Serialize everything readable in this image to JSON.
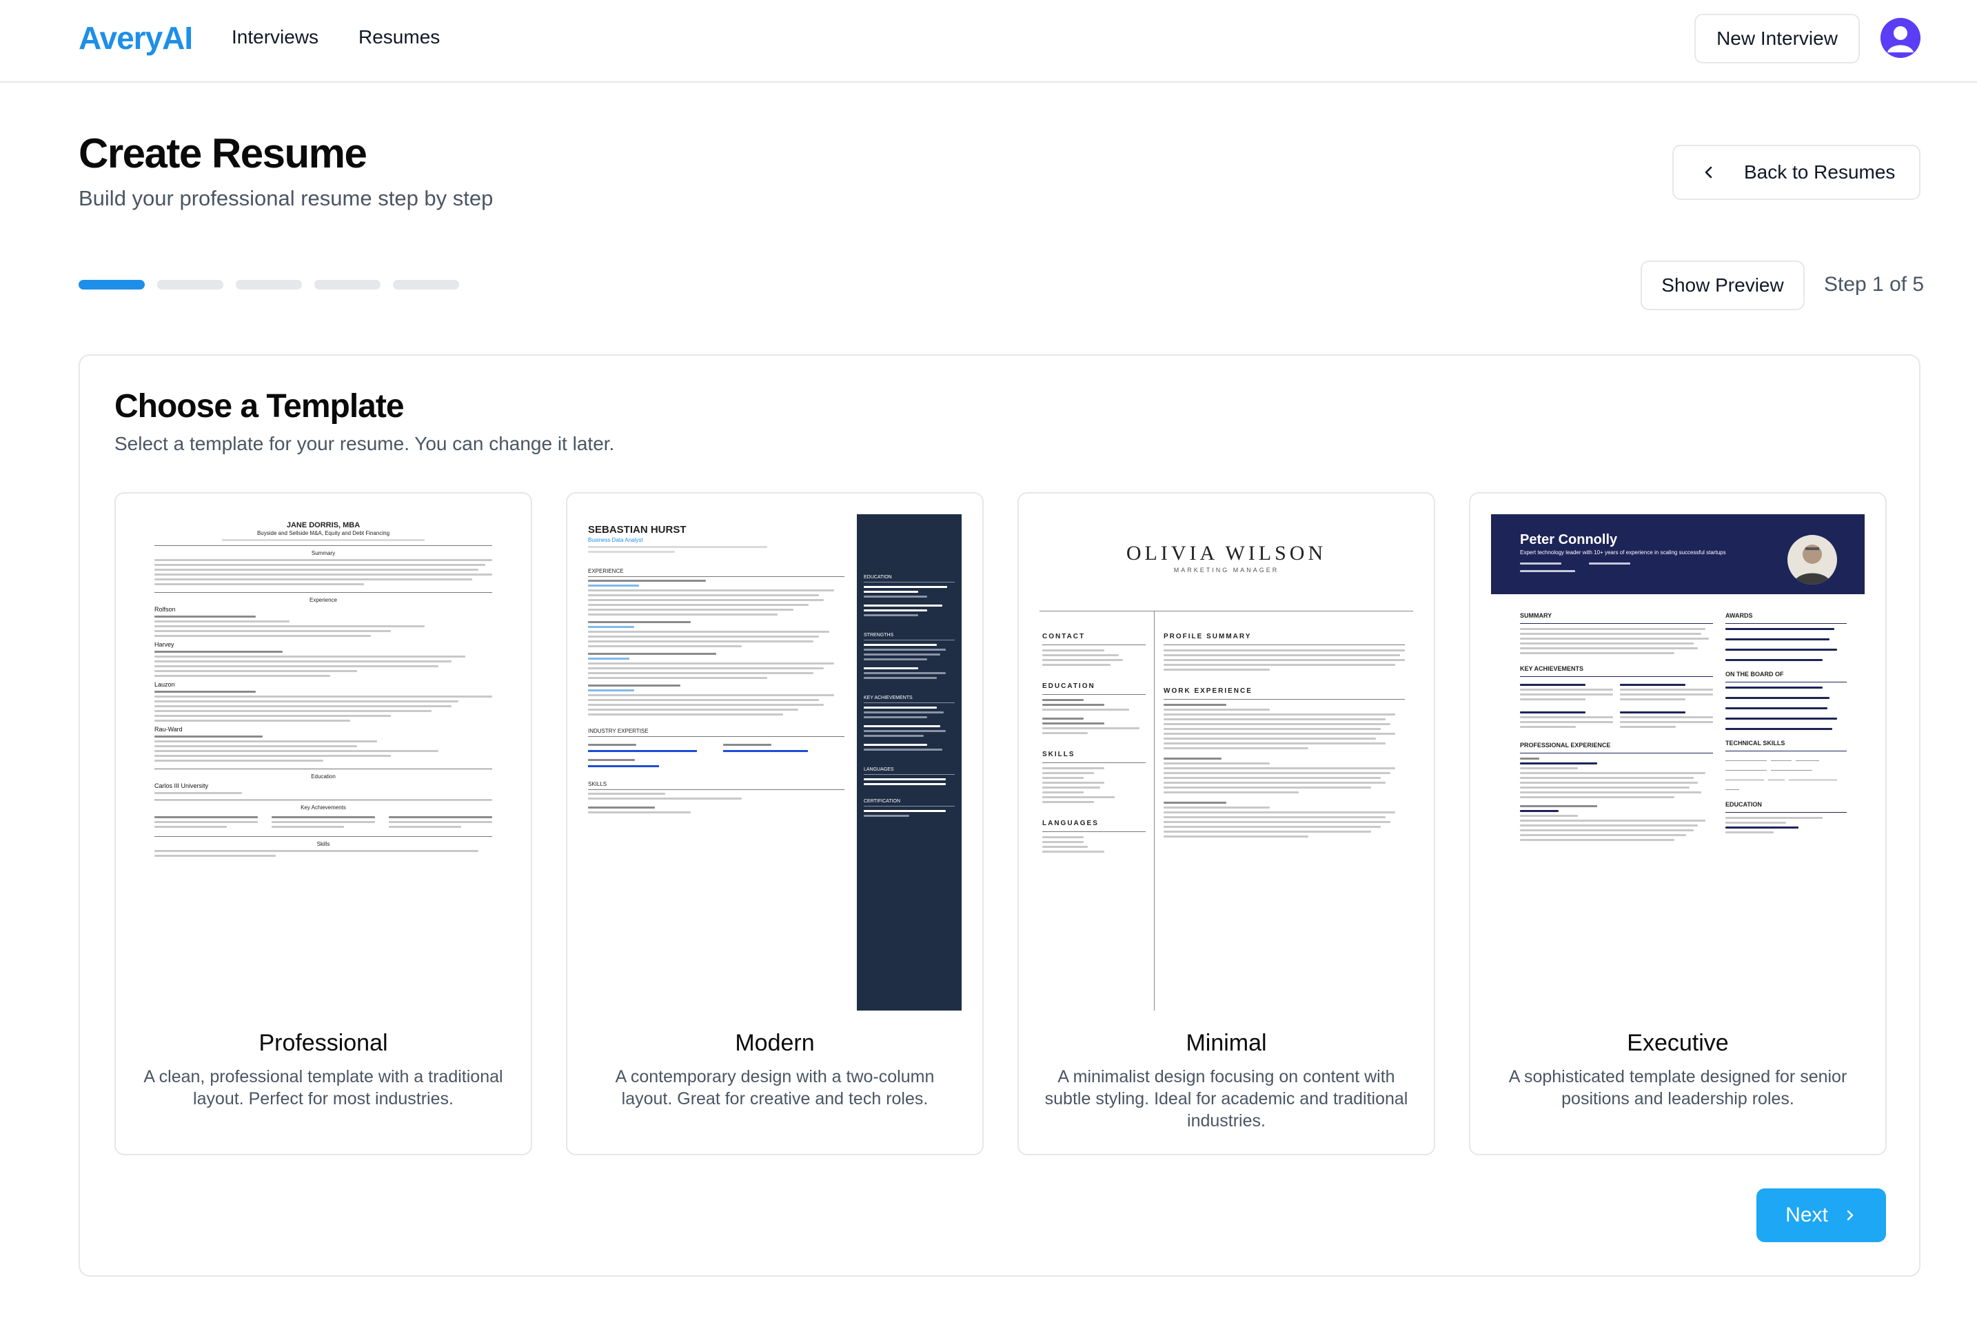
{
  "header": {
    "brand": "AveryAI",
    "nav": [
      "Interviews",
      "Resumes"
    ],
    "new_interview": "New Interview",
    "avatar_icon": "user-avatar-icon"
  },
  "page": {
    "title": "Create Resume",
    "subtitle": "Build your professional resume step by step",
    "back_button": "Back to Resumes",
    "show_preview": "Show Preview",
    "step_label": "Step 1 of 5",
    "progress": {
      "current": 1,
      "total": 5
    }
  },
  "card": {
    "title": "Choose a Template",
    "subtitle": "Select a template for your resume. You can change it later.",
    "next_button": "Next"
  },
  "templates": [
    {
      "name": "Professional",
      "description": "A clean, professional template with a traditional layout. Perfect for most industries.",
      "preview": {
        "name": "JANE DORRIS, MBA",
        "headline": "Buyside and Sellside M&A, Equity and Debt Financing",
        "sections": [
          "Summary",
          "Experience",
          "Education",
          "Key Achievements",
          "Skills"
        ],
        "employers": [
          "Rolfson",
          "Harvey",
          "Lauzon",
          "Rau-Ward"
        ],
        "school": "Carlos III University"
      }
    },
    {
      "name": "Modern",
      "description": "A contemporary design with a two-column layout. Great for creative and tech roles.",
      "preview": {
        "name": "SEBASTIAN HURST",
        "role": "Business Data Analyst",
        "sections": [
          "EXPERIENCE",
          "INDUSTRY EXPERTISE",
          "SKILLS"
        ],
        "side_sections": [
          "EDUCATION",
          "STRENGTHS",
          "KEY ACHIEVEMENTS",
          "LANGUAGES",
          "CERTIFICATION"
        ]
      }
    },
    {
      "name": "Minimal",
      "description": "A minimalist design focusing on content with subtle styling. Ideal for academic and traditional industries.",
      "preview": {
        "name": "OLIVIA WILSON",
        "role": "MARKETING MANAGER",
        "left_sections": [
          "CONTACT",
          "EDUCATION",
          "SKILLS",
          "LANGUAGES"
        ],
        "right_sections": [
          "PROFILE SUMMARY",
          "WORK EXPERIENCE"
        ]
      }
    },
    {
      "name": "Executive",
      "description": "A sophisticated template designed for senior positions and leadership roles.",
      "preview": {
        "name": "Peter Connolly",
        "headline": "Expert technology leader with 10+ years of experience in scaling successful startups",
        "left_sections": [
          "SUMMARY",
          "KEY ACHIEVEMENTS",
          "PROFESSIONAL EXPERIENCE"
        ],
        "right_sections": [
          "AWARDS",
          "ON THE BOARD OF",
          "TECHNICAL SKILLS",
          "EDUCATION"
        ]
      }
    }
  ],
  "colors": {
    "accent": "#1d8fe8",
    "next_button": "#1ea7f5",
    "avatar": "#5b3df5",
    "modern_sidebar": "#1f2d45",
    "executive_header": "#1d2458"
  }
}
